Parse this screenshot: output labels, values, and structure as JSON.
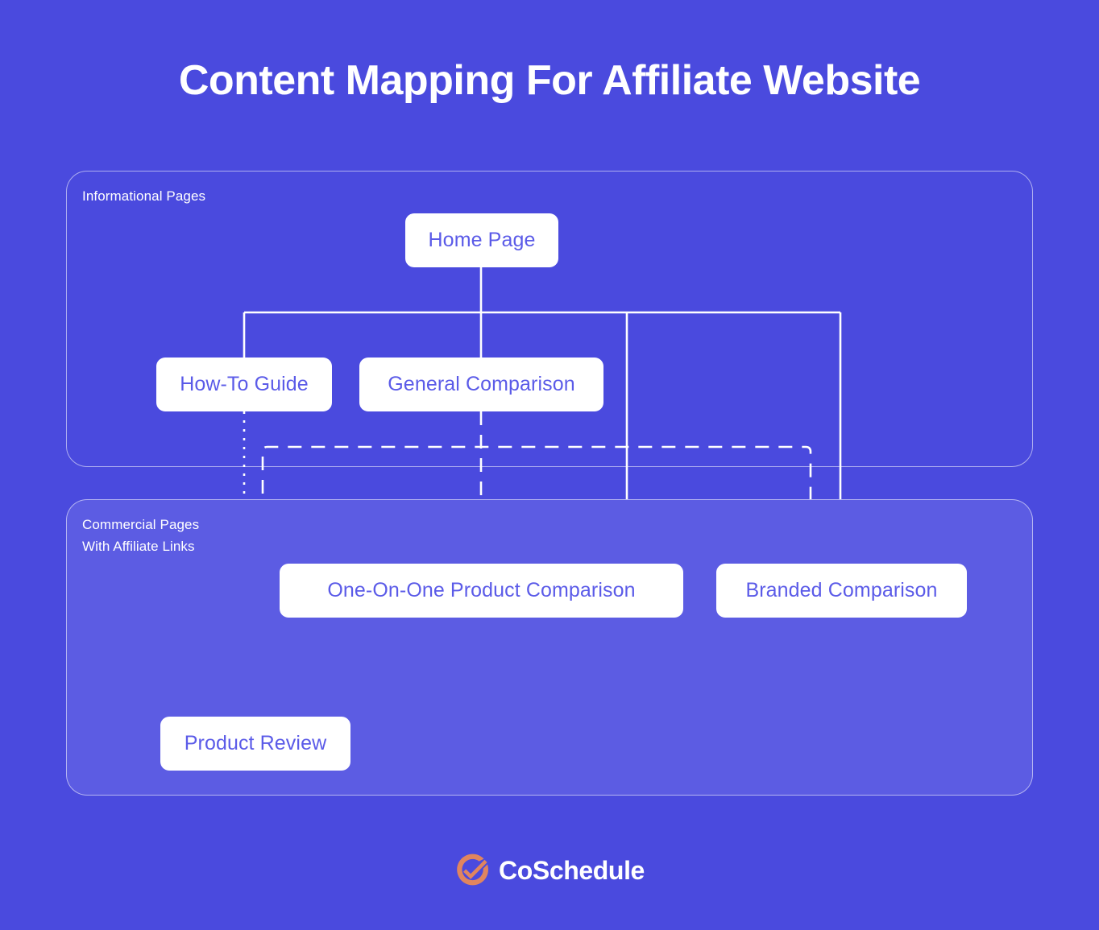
{
  "title": "Content Mapping For Affiliate Website",
  "colors": {
    "background": "#4a4ade",
    "commercial_panel": "#5c5ce3",
    "node_fill": "#ffffff",
    "node_text": "#5b5be8",
    "line": "#ffffff",
    "logo_mark": "#e0855f",
    "logo_text": "#ffffff"
  },
  "panels": [
    {
      "id": "informational",
      "label": "Informational Pages"
    },
    {
      "id": "commercial",
      "label": "Commercial Pages\nWith Affiliate Links"
    }
  ],
  "nodes": [
    {
      "id": "home",
      "label": "Home Page"
    },
    {
      "id": "howto",
      "label": "How-To Guide"
    },
    {
      "id": "general",
      "label": "General Comparison"
    },
    {
      "id": "oneonone",
      "label": "One-On-One Product Comparison"
    },
    {
      "id": "branded",
      "label": "Branded Comparison"
    },
    {
      "id": "review",
      "label": "Product Review"
    }
  ],
  "connections": [
    {
      "from": "home",
      "to": "howto",
      "style": "solid"
    },
    {
      "from": "home",
      "to": "general",
      "style": "solid"
    },
    {
      "from": "home",
      "to": "oneonone",
      "style": "solid"
    },
    {
      "from": "home",
      "to": "branded",
      "style": "solid"
    },
    {
      "from": "home",
      "to": "review",
      "style": "solid"
    },
    {
      "from": "howto",
      "to": "review",
      "style": "dotted"
    },
    {
      "from": "general",
      "to": "oneonone",
      "style": "dashed"
    },
    {
      "from": "review",
      "to": "oneonone",
      "style": "dashed"
    },
    {
      "from": "review",
      "to": "branded",
      "style": "dashed"
    },
    {
      "from": "howto",
      "to": "oneonone",
      "style": "dotted"
    },
    {
      "from": "howto",
      "to": "branded",
      "style": "dotted"
    }
  ],
  "footer": {
    "brand": "CoSchedule",
    "mark_icon": "check-circle-icon"
  }
}
